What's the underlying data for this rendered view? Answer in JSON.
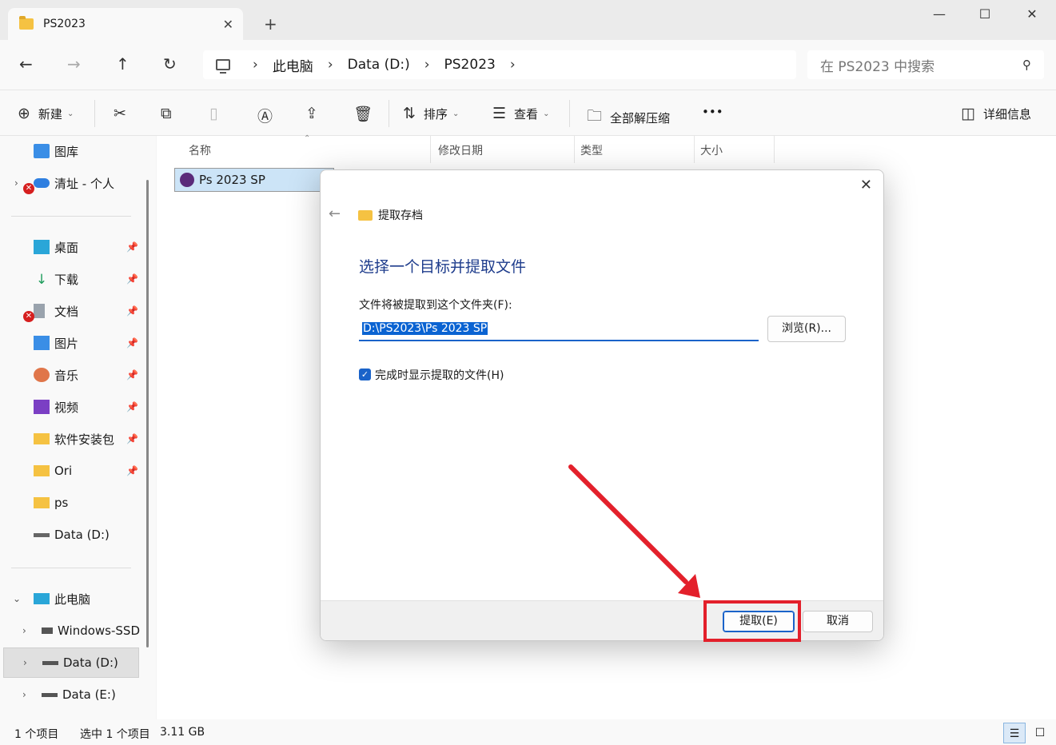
{
  "window": {
    "tab_title": "PS2023",
    "tab_close": "✕",
    "tab_add": "+",
    "minimize": "—",
    "maximize": "☐",
    "close": "✕"
  },
  "address": {
    "crumbs": [
      "此电脑",
      "Data (D:)",
      "PS2023"
    ],
    "separator": "›",
    "search_placeholder": "在 PS2023 中搜索"
  },
  "toolbar": {
    "new": "新建",
    "sort": "排序",
    "view": "查看",
    "extract_all": "全部解压缩",
    "more": "•••",
    "details": "详细信息"
  },
  "sidebar": {
    "items": [
      {
        "label": "图库",
        "icon": "gallery-icon"
      },
      {
        "label": "清址 - 个人",
        "icon": "onedrive-icon"
      },
      {
        "label": "桌面",
        "icon": "desktop-icon"
      },
      {
        "label": "下载",
        "icon": "download-icon"
      },
      {
        "label": "文档",
        "icon": "document-icon"
      },
      {
        "label": "图片",
        "icon": "pictures-icon"
      },
      {
        "label": "音乐",
        "icon": "music-icon"
      },
      {
        "label": "视频",
        "icon": "video-icon"
      },
      {
        "label": "软件安装包",
        "icon": "folder-icon"
      },
      {
        "label": "Ori",
        "icon": "folder-icon"
      },
      {
        "label": "ps",
        "icon": "folder-icon"
      },
      {
        "label": "Data (D:)",
        "icon": "drive-icon"
      },
      {
        "label": "此电脑",
        "icon": "computer-icon"
      },
      {
        "label": "Windows-SSD",
        "icon": "windows-drive-icon"
      },
      {
        "label": "Data (D:)",
        "icon": "drive-icon"
      },
      {
        "label": "Data (E:)",
        "icon": "drive-icon"
      }
    ]
  },
  "columns": [
    "名称",
    "修改日期",
    "类型",
    "大小"
  ],
  "files": [
    {
      "name": "Ps 2023 SP"
    }
  ],
  "status": {
    "count": "1 个项目",
    "selected": "选中 1 个项目",
    "size": "3.11 GB"
  },
  "dialog": {
    "caption": "提取存档",
    "heading": "选择一个目标并提取文件",
    "label": "文件将被提取到这个文件夹(F):",
    "path": "D:\\PS2023\\Ps 2023 SP",
    "browse": "浏览(R)...",
    "checkbox_label": "完成时显示提取的文件(H)",
    "checkbox_checked": true,
    "extract": "提取(E)",
    "cancel": "取消",
    "close": "✕",
    "back": "←"
  },
  "colors": {
    "accent": "#1a63c9",
    "annotation_red": "#e3202b",
    "heading_blue": "#1e3c8c"
  }
}
